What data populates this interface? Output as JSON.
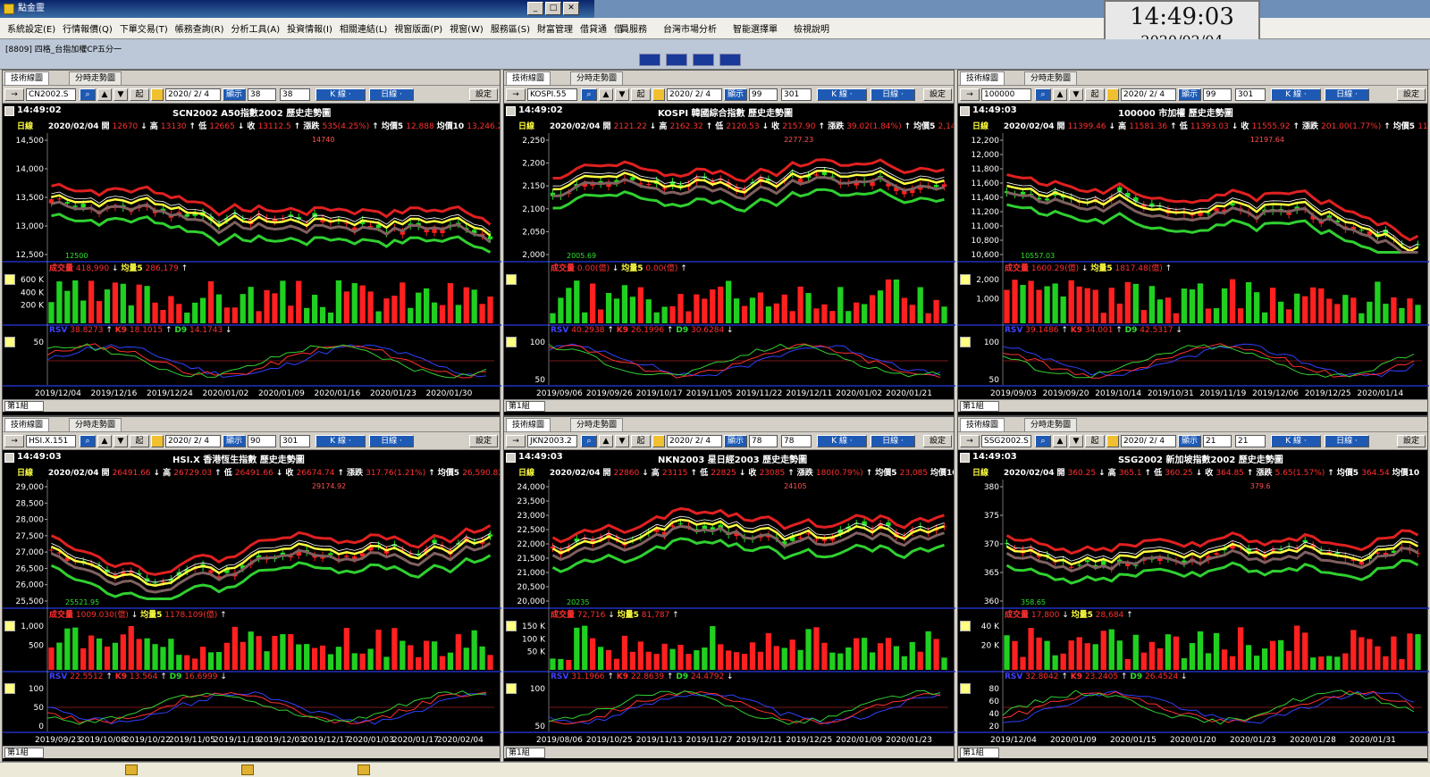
{
  "app": {
    "title": "點金靈",
    "subwindow": "[8809] 四格_台指加權CP五分一"
  },
  "menu": [
    "系統設定(E)",
    "行情報價(Q)",
    "下單交易(T)",
    "帳務查詢(R)",
    "分析工具(A)",
    "投資情報(I)",
    "相關連結(L)",
    "視窗版面(P)",
    "視窗(W)",
    "服務區(S)",
    "財富管理",
    "借貸通",
    "借"
  ],
  "menu_right": [
    "員服務",
    "台灣市場分析",
    "智能選擇單",
    "檢視說明"
  ],
  "clock": {
    "time": "14:49:03",
    "date": "2020/02/04",
    "flag": "F"
  },
  "common": {
    "tab_tech": "技術線圖",
    "tab_minute": "分時走勢圖",
    "btn_start": "起",
    "btn_show": "顯示",
    "btn_kline": "K 線 ·",
    "btn_daily": "日線 ·",
    "btn_settings": "設定",
    "group": "第1組",
    "kd_rsv": "RSV",
    "kd_k": "K9",
    "kd_d": "D9",
    "vol_label": "成交量",
    "avg5_label": "均量5",
    "daily": "日線"
  },
  "panels": [
    {
      "symbol": "CN2002.S",
      "date": "2020/ 2/ 4",
      "show_a": "38",
      "show_b": "38",
      "time": "14:49:02",
      "name": "SCN2002 A50指數2002  歷史走勢圖",
      "quote": {
        "date": "2020/02/04",
        "open": "12670",
        "high": "13130",
        "low": "12665",
        "close": "13112.5",
        "chg": "535(4.25%)",
        "ma5": "12,888",
        "ma10": "13,246.25"
      },
      "price_ticks": [
        "14,500",
        "14,000",
        "13,500",
        "13,000",
        "12,500"
      ],
      "annotations": [
        "14740",
        "12500"
      ],
      "volume": {
        "value": "418,990",
        "avg5": "286,179"
      },
      "vol_ticks": [
        "600 K",
        "400 K",
        "200 K"
      ],
      "kd": {
        "rsv": "38.8273",
        "k": "18.1015",
        "d": "14.1743"
      },
      "kd_ticks": [
        "50"
      ],
      "dates": [
        "2019/12/04",
        "2019/12/16",
        "2019/12/24",
        "2020/01/02",
        "2020/01/09",
        "2020/01/16",
        "2020/01/23",
        "2020/01/30"
      ]
    },
    {
      "symbol": "KOSPI.55",
      "date": "2020/ 2/ 4",
      "show_a": "99",
      "show_b": "301",
      "time": "14:49:02",
      "name": "KOSPI 韓國綜合指數  歷史走勢圖",
      "quote": {
        "date": "2020/02/04",
        "open": "2121.22",
        "high": "2162.32",
        "low": "2120.53",
        "close": "2157.90",
        "chg": "39.02(1.84%)",
        "ma5": "2,145.814",
        "ma10": ""
      },
      "price_ticks": [
        "2,250",
        "2,200",
        "2,150",
        "2,100",
        "2,050",
        "2,000"
      ],
      "annotations": [
        "2277.23",
        "2005.69"
      ],
      "volume": {
        "value": "0.00(億)",
        "avg5": "0.00(億)"
      },
      "vol_ticks": [],
      "kd": {
        "rsv": "40.2938",
        "k": "26.1996",
        "d": "30.6284"
      },
      "kd_ticks": [
        "100",
        "50"
      ],
      "dates": [
        "2019/09/06",
        "2019/09/26",
        "2019/10/17",
        "2019/11/05",
        "2019/11/22",
        "2019/12/11",
        "2020/01/02",
        "2020/01/21"
      ]
    },
    {
      "symbol": "100000",
      "date": "2020/ 2/ 4",
      "show_a": "99",
      "show_b": "301",
      "time": "14:49:03",
      "name": "100000 市加權  歷史走勢圖",
      "quote": {
        "date": "2020/02/04",
        "open": "11399.46",
        "high": "11581.36",
        "low": "11393.03",
        "close": "11555.92",
        "chg": "201.00(1.77%)",
        "ma5": "11,",
        "ma10": ""
      },
      "price_ticks": [
        "12,200",
        "12,000",
        "11,800",
        "11,600",
        "11,400",
        "11,200",
        "11,000",
        "10,800",
        "10,600"
      ],
      "annotations": [
        "12197.64",
        "10557.03"
      ],
      "volume": {
        "value": "1600.29(億)",
        "avg5": "1817.48(億)"
      },
      "vol_ticks": [
        "2,000",
        "1,000"
      ],
      "kd": {
        "rsv": "39.1486",
        "k": "34.001",
        "d": "42.5317"
      },
      "kd_ticks": [
        "100",
        "50"
      ],
      "dates": [
        "2019/09/03",
        "2019/09/20",
        "2019/10/14",
        "2019/10/31",
        "2019/11/19",
        "2019/12/06",
        "2019/12/25",
        "2020/01/14"
      ]
    },
    {
      "symbol": "HSI.X.151",
      "date": "2020/ 2/ 4",
      "show_a": "90",
      "show_b": "301",
      "time": "14:49:03",
      "name": "HSI.X 香港恆生指數  歷史走勢圖",
      "quote": {
        "date": "2020/02/04",
        "open": "26491.66",
        "high": "26729.03",
        "low": "26491.66",
        "close": "26674.74",
        "chg": "317.76(1.21%)",
        "ma5": "26,590.822",
        "ma10": ""
      },
      "price_ticks": [
        "29,000",
        "28,500",
        "28,000",
        "27,500",
        "27,000",
        "26,500",
        "26,000",
        "25,500"
      ],
      "annotations": [
        "29174.92",
        "25521.95"
      ],
      "volume": {
        "value": "1009.030(億)",
        "avg5": "1178.109(億)"
      },
      "vol_ticks": [
        "1,000",
        "500"
      ],
      "kd": {
        "rsv": "22.5512",
        "k": "13.564",
        "d": "16.6999"
      },
      "kd_ticks": [
        "100",
        "50",
        "0"
      ],
      "dates": [
        "2019/09/23",
        "2019/10/08",
        "2019/10/22",
        "2019/11/05",
        "2019/11/19",
        "2019/12/03",
        "2019/12/17",
        "2020/01/03",
        "2020/01/17",
        "2020/02/04"
      ]
    },
    {
      "symbol": "JKN2003.2",
      "date": "2020/ 2/ 4",
      "show_a": "78",
      "show_b": "78",
      "time": "14:49:03",
      "name": "NKN2003 星日經2003  歷史走勢圖",
      "quote": {
        "date": "2020/02/04",
        "open": "22860",
        "high": "23115",
        "low": "22825",
        "close": "23085",
        "chg": "180(0.79%)",
        "ma5": "23,085",
        "ma10": ""
      },
      "price_ticks": [
        "24,000",
        "23,500",
        "23,000",
        "22,500",
        "22,000",
        "21,500",
        "21,000",
        "20,500",
        "20,000"
      ],
      "annotations": [
        "24105",
        "20235"
      ],
      "volume": {
        "value": "72,716",
        "avg5": "81,787"
      },
      "vol_ticks": [
        "150 K",
        "100 K",
        "50 K"
      ],
      "kd": {
        "rsv": "31.1966",
        "k": "22.8639",
        "d": "24.4792"
      },
      "kd_ticks": [
        "100",
        "50"
      ],
      "dates": [
        "2019/08/06",
        "2019/10/25",
        "2019/11/13",
        "2019/11/27",
        "2019/12/11",
        "2019/12/25",
        "2020/01/09",
        "2020/01/23"
      ]
    },
    {
      "symbol": "SSG2002.S",
      "date": "2020/ 2/ 4",
      "show_a": "21",
      "show_b": "21",
      "time": "14:49:03",
      "name": "SSG2002 新加坡指數2002  歷史走勢圖",
      "quote": {
        "date": "2020/02/04",
        "open": "360.25",
        "high": "365.1",
        "low": "360.25",
        "close": "364.85",
        "chg": "5.65(1.57%)",
        "ma5": "364.54",
        "ma10": ""
      },
      "price_ticks": [
        "380",
        "375",
        "370",
        "365",
        "360"
      ],
      "annotations": [
        "379.6",
        "358.65"
      ],
      "volume": {
        "value": "17,800",
        "avg5": "28,684"
      },
      "vol_ticks": [
        "40 K",
        "20 K"
      ],
      "kd": {
        "rsv": "32.8042",
        "k": "23.2405",
        "d": "26.4524"
      },
      "kd_ticks": [
        "80",
        "60",
        "40",
        "20"
      ],
      "dates": [
        "2019/12/04",
        "2020/01/09",
        "2020/01/15",
        "2020/01/20",
        "2020/01/23",
        "2020/01/28",
        "2020/01/31"
      ]
    }
  ]
}
